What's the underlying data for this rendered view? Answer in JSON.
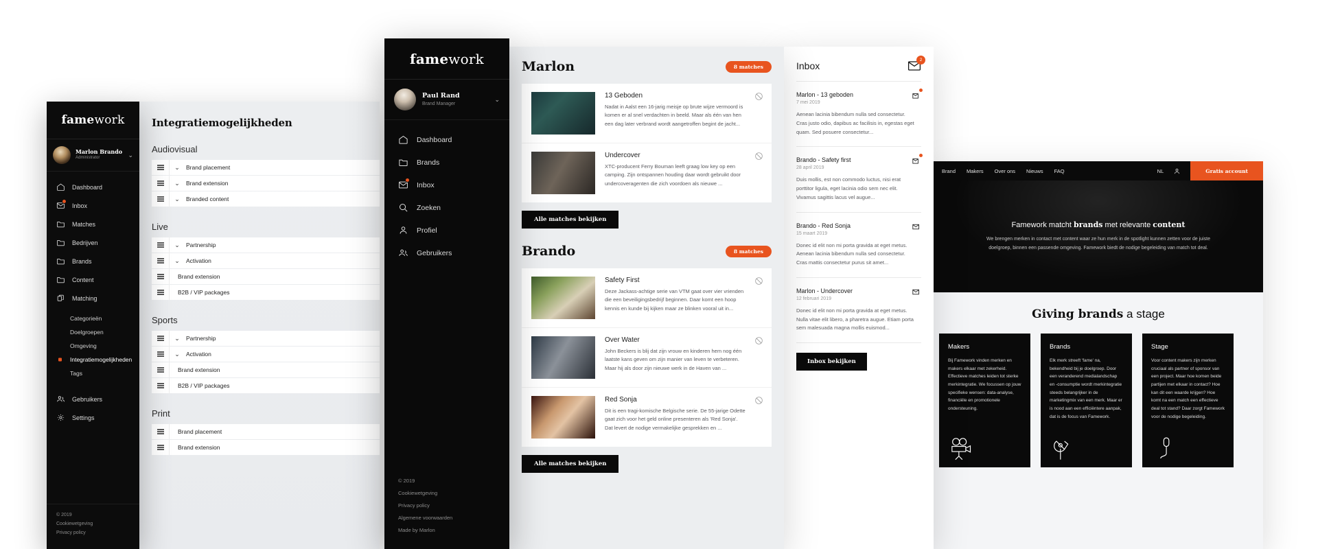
{
  "brand": {
    "bold": "fame",
    "light": "work",
    "accent": "#e8541f"
  },
  "admin_sidebar": {
    "user": {
      "name": "Marlon Brando",
      "role": "Administrator"
    },
    "items": [
      {
        "label": "Dashboard",
        "icon": "home-icon"
      },
      {
        "label": "Inbox",
        "icon": "envelope-icon",
        "badge": true
      },
      {
        "label": "Matches",
        "icon": "folder-icon"
      },
      {
        "label": "Bedrijven",
        "icon": "folder-icon"
      },
      {
        "label": "Brands",
        "icon": "folder-icon"
      },
      {
        "label": "Content",
        "icon": "folder-icon"
      },
      {
        "label": "Matching",
        "icon": "copy-icon"
      }
    ],
    "subitems": [
      {
        "label": "Categorieën",
        "active": false
      },
      {
        "label": "Doelgroepen",
        "active": false
      },
      {
        "label": "Omgeving",
        "active": false
      },
      {
        "label": "Integratiemogelijkheden",
        "active": true
      },
      {
        "label": "Tags",
        "active": false
      }
    ],
    "bottom_items": [
      {
        "label": "Gebruikers",
        "icon": "users-icon"
      },
      {
        "label": "Settings",
        "icon": "gear-icon"
      }
    ],
    "footer": [
      "© 2019",
      "Cookiewetgeving",
      "Privacy policy"
    ]
  },
  "integraties": {
    "title": "Integratiemogelijkheden",
    "sections": [
      {
        "heading": "Audiovisual",
        "rows": [
          {
            "label": "Brand placement",
            "chevron": true
          },
          {
            "label": "Brand extension",
            "chevron": true
          },
          {
            "label": "Branded content",
            "chevron": true
          }
        ]
      },
      {
        "heading": "Live",
        "rows": [
          {
            "label": "Partnership",
            "chevron": true
          },
          {
            "label": "Activation",
            "chevron": true
          },
          {
            "label": "Brand extension",
            "chevron": false
          },
          {
            "label": "B2B / VIP packages",
            "chevron": false
          }
        ]
      },
      {
        "heading": "Sports",
        "rows": [
          {
            "label": "Partnership",
            "chevron": true
          },
          {
            "label": "Activation",
            "chevron": true
          },
          {
            "label": "Brand extension",
            "chevron": false
          },
          {
            "label": "B2B / VIP packages",
            "chevron": false
          }
        ]
      },
      {
        "heading": "Print",
        "rows": [
          {
            "label": "Brand placement",
            "chevron": false
          },
          {
            "label": "Brand extension",
            "chevron": false
          }
        ]
      }
    ]
  },
  "manager_sidebar": {
    "user": {
      "name": "Paul Rand",
      "role": "Brand Manager"
    },
    "items": [
      {
        "label": "Dashboard",
        "icon": "home-icon"
      },
      {
        "label": "Brands",
        "icon": "folder-icon"
      },
      {
        "label": "Inbox",
        "icon": "envelope-icon",
        "badge": true
      },
      {
        "label": "Zoeken",
        "icon": "search-icon"
      },
      {
        "label": "Profiel",
        "icon": "person-icon"
      },
      {
        "label": "Gebruikers",
        "icon": "users-icon"
      }
    ],
    "footer": [
      "© 2019",
      "Cookiewetgeving",
      "Privacy policy",
      "Algemene voorwaarden",
      "Made by Marlon"
    ]
  },
  "matches": {
    "view_all_label": "Alle matches bekijken",
    "groups": [
      {
        "title": "Marlon",
        "count_label": "8 matches",
        "items": [
          {
            "title": "13 Geboden",
            "desc": "Nadat in Aalst een 16-jarig meisje op brute wijze vermoord is komen er al snel verdachten in beeld. Maar als één van hen een dag later verbrand wordt aangetroffen begint de jacht..."
          },
          {
            "title": "Undercover",
            "desc": "XTC-producent Ferry Bouman leeft graag low key op een camping. Zijn ontspannen houding daar wordt gebruikt door undercoveragenten die zich voordoen als nieuwe ..."
          }
        ]
      },
      {
        "title": "Brando",
        "count_label": "8 matches",
        "items": [
          {
            "title": "Safety First",
            "desc": "Deze Jackass-achtige serie van VTM gaat over vier vrienden die een beveiligingsbedrijf beginnen. Daar komt een hoop kennis en kunde bij kijken maar ze blinken vooral uit in..."
          },
          {
            "title": "Over Water",
            "desc": "John Beckers is blij dat zijn vrouw en kinderen hem nog één laatste kans geven om zijn manier van leven te verbeteren. Maar hij als door zijn nieuwe werk in de Haven van ..."
          },
          {
            "title": "Red Sonja",
            "desc": "Dit is een tragi-komische Belgische serie. De 55-jarige Odette gaat zich voor het geld online presenteren als 'Red Sonja'. Dat levert de nodige vermakelijke gesprekken en ..."
          }
        ]
      }
    ]
  },
  "inbox": {
    "title": "Inbox",
    "unread_count": "2",
    "button_label": "Inbox bekijken",
    "messages": [
      {
        "title": "Marlon - 13 geboden",
        "date": "7 mei 2019",
        "unread": true,
        "body": "Aenean lacinia bibendum nulla sed consectetur. Cras justo odio, dapibus ac facilisis in, egestas eget quam. Sed posuere consectetur..."
      },
      {
        "title": "Brando - Safety first",
        "date": "28 april 2019",
        "unread": true,
        "body": "Duis mollis, est non commodo luctus, nisi erat porttitor ligula, eget lacinia odio sem nec elit. Vivamus sagittis lacus vel augue..."
      },
      {
        "title": "Brando - Red Sonja",
        "date": "15 maart 2019",
        "unread": false,
        "body": "Donec id elit non mi porta gravida at eget metus. Aenean lacinia bibendum nulla sed consectetur. Cras mattis consectetur purus sit amet..."
      },
      {
        "title": "Marlon - Undercover",
        "date": "12 februari 2019",
        "unread": false,
        "body": "Donec id elit non mi porta gravida at eget metus. Nulla vitae elit libero, a pharetra augue. Etiam porta sem malesuada magna mollis euismod..."
      }
    ]
  },
  "website": {
    "nav": [
      "Brand",
      "Makers",
      "Over ons",
      "Nieuws",
      "FAQ"
    ],
    "lang": "NL",
    "cta": "Gratis account",
    "hero": {
      "title_pre": "Famework matcht ",
      "title_b1": "brands",
      "title_mid": " met relevante ",
      "title_b2": "content",
      "body": "We brengen merken in contact met content waar ze hun merk in de spotlight kunnen zetten voor de juiste doelgroep, binnen een passende omgeving. Famework biedt de nodige begeleiding van match tot deal."
    },
    "stage": {
      "title_b": "Giving brands",
      "title_rest": " a stage",
      "cards": [
        {
          "title": "Makers",
          "icon": "camera-icon",
          "body": "Bij Famework vinden merken en makers elkaar met zekerheid. Effectieve matches leiden tot sterke merkintegratie. We focussen op jouw specifieke wensen: data-analyse, financiële en promotionele ondersteuning."
        },
        {
          "title": "Brands",
          "icon": "spotlight-icon",
          "body": "Elk merk streeft 'fame' na, bekendheid bij je doelgroep. Door een veranderend medialandschap en -consumptie wordt merkintegratie steeds belangrijker in de marketingmix van een merk. Maar er is nood aan een efficiëntere aanpak, dat is de focus van Famework."
        },
        {
          "title": "Stage",
          "icon": "microphone-icon",
          "body": "Voor content makers zijn merken cruciaal als partner of sponsor van een project. Maar hoe komen beide partijen met elkaar in contact? Hoe kan dit een waarde krijgen? Hoe komt na een match een effectieve deal tot stand? Daar zorgt Famework voor de nodige begeleiding."
        }
      ]
    }
  }
}
